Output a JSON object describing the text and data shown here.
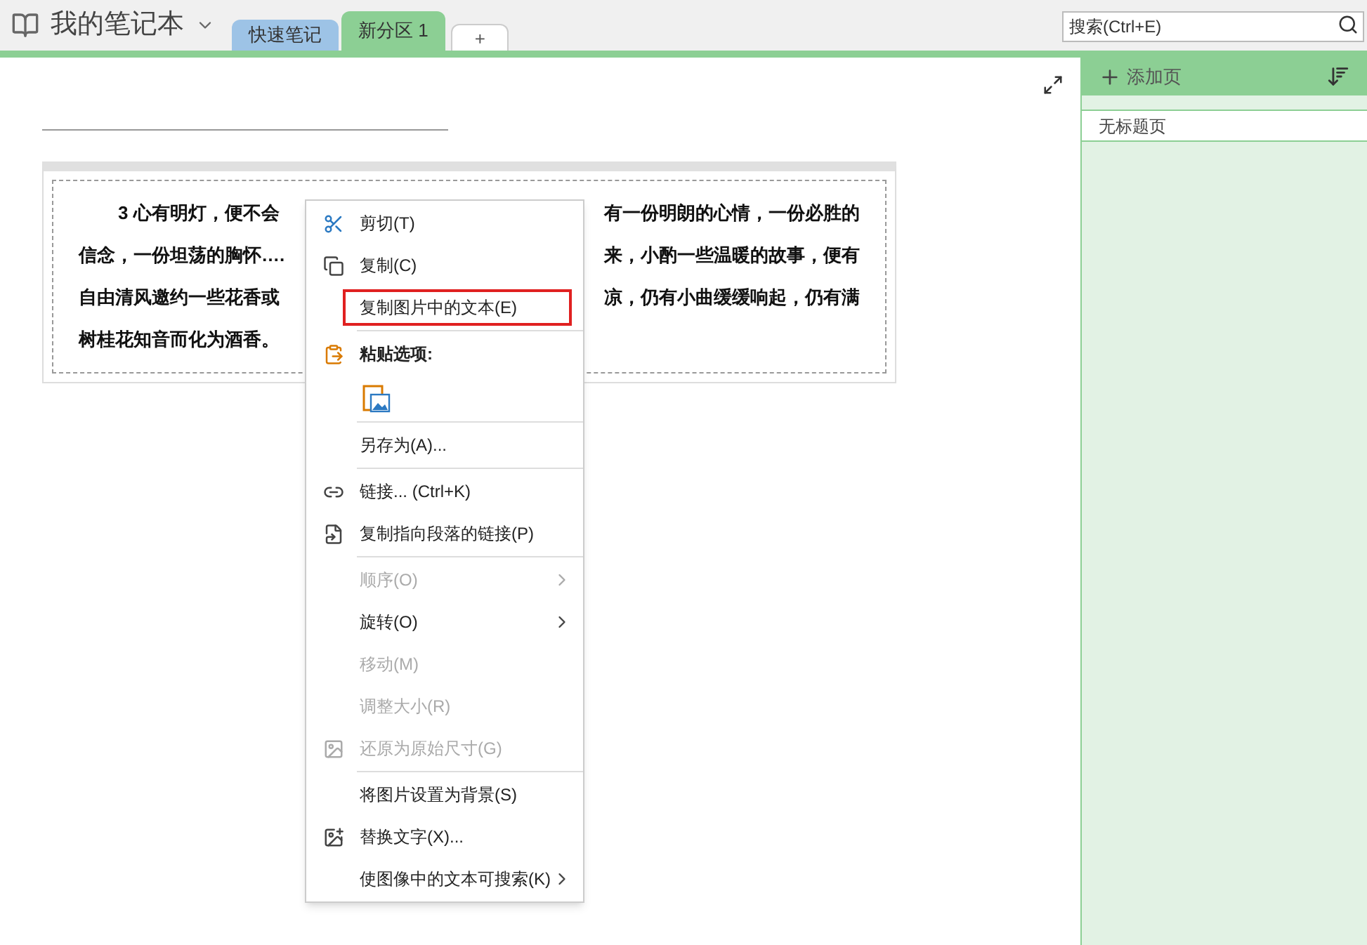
{
  "notebook": {
    "title": "我的笔记本"
  },
  "section_tabs": [
    {
      "label": "快速笔记",
      "selected": false,
      "color": "#9dc3e6"
    },
    {
      "label": "新分区 1",
      "selected": true,
      "color": "#8ccf94"
    }
  ],
  "add_tab": {
    "label": "+"
  },
  "search": {
    "placeholder": "搜索(Ctrl+E)"
  },
  "pages_panel": {
    "add_page": "添加页",
    "pages": [
      {
        "title": "无标题页",
        "selected": true
      }
    ]
  },
  "note": {
    "lines": [
      {
        "left": "3  心有明灯，便不会",
        "right": "有一份明朗的心情，一份必胜的",
        "indent": true
      },
      {
        "left": "信念，一份坦荡的胸怀….",
        "right": "来，小酌一些温暖的故事，便有",
        "indent": false
      },
      {
        "left": "自由清风邀约一些花香或",
        "right": "凉，仍有小曲缓缓响起，仍有满",
        "indent": false
      },
      {
        "left": "树桂花知音而化为酒香。",
        "indent": false
      }
    ]
  },
  "context_menu": [
    {
      "kind": "item",
      "label": "剪切(T)",
      "disabled": false,
      "submenu": false,
      "highlighted": false
    },
    {
      "kind": "item",
      "label": "复制(C)",
      "disabled": false,
      "submenu": false,
      "highlighted": false
    },
    {
      "kind": "item",
      "label": "复制图片中的文本(E)",
      "disabled": false,
      "submenu": false,
      "highlighted": true
    },
    {
      "kind": "separator"
    },
    {
      "kind": "heading",
      "label": "粘贴选项:"
    },
    {
      "kind": "paste-option"
    },
    {
      "kind": "separator"
    },
    {
      "kind": "item",
      "label": "另存为(A)...",
      "disabled": false,
      "submenu": false,
      "highlighted": false
    },
    {
      "kind": "separator"
    },
    {
      "kind": "item",
      "label": "链接...  (Ctrl+K)",
      "disabled": false,
      "submenu": false,
      "highlighted": false
    },
    {
      "kind": "item",
      "label": "复制指向段落的链接(P)",
      "disabled": false,
      "submenu": false,
      "highlighted": false
    },
    {
      "kind": "separator"
    },
    {
      "kind": "item",
      "label": "顺序(O)",
      "disabled": true,
      "submenu": true,
      "highlighted": false
    },
    {
      "kind": "item",
      "label": "旋转(O)",
      "disabled": false,
      "submenu": true,
      "highlighted": false
    },
    {
      "kind": "item",
      "label": "移动(M)",
      "disabled": true,
      "submenu": false,
      "highlighted": false
    },
    {
      "kind": "item",
      "label": "调整大小(R)",
      "disabled": true,
      "submenu": false,
      "highlighted": false
    },
    {
      "kind": "item",
      "label": "还原为原始尺寸(G)",
      "disabled": true,
      "submenu": false,
      "highlighted": false
    },
    {
      "kind": "separator"
    },
    {
      "kind": "item",
      "label": "将图片设置为背景(S)",
      "disabled": false,
      "submenu": false,
      "highlighted": false
    },
    {
      "kind": "item",
      "label": "替换文字(X)...",
      "disabled": false,
      "submenu": false,
      "highlighted": false
    },
    {
      "kind": "item",
      "label": "使图像中的文本可搜索(K)",
      "disabled": false,
      "submenu": true,
      "highlighted": false
    }
  ]
}
